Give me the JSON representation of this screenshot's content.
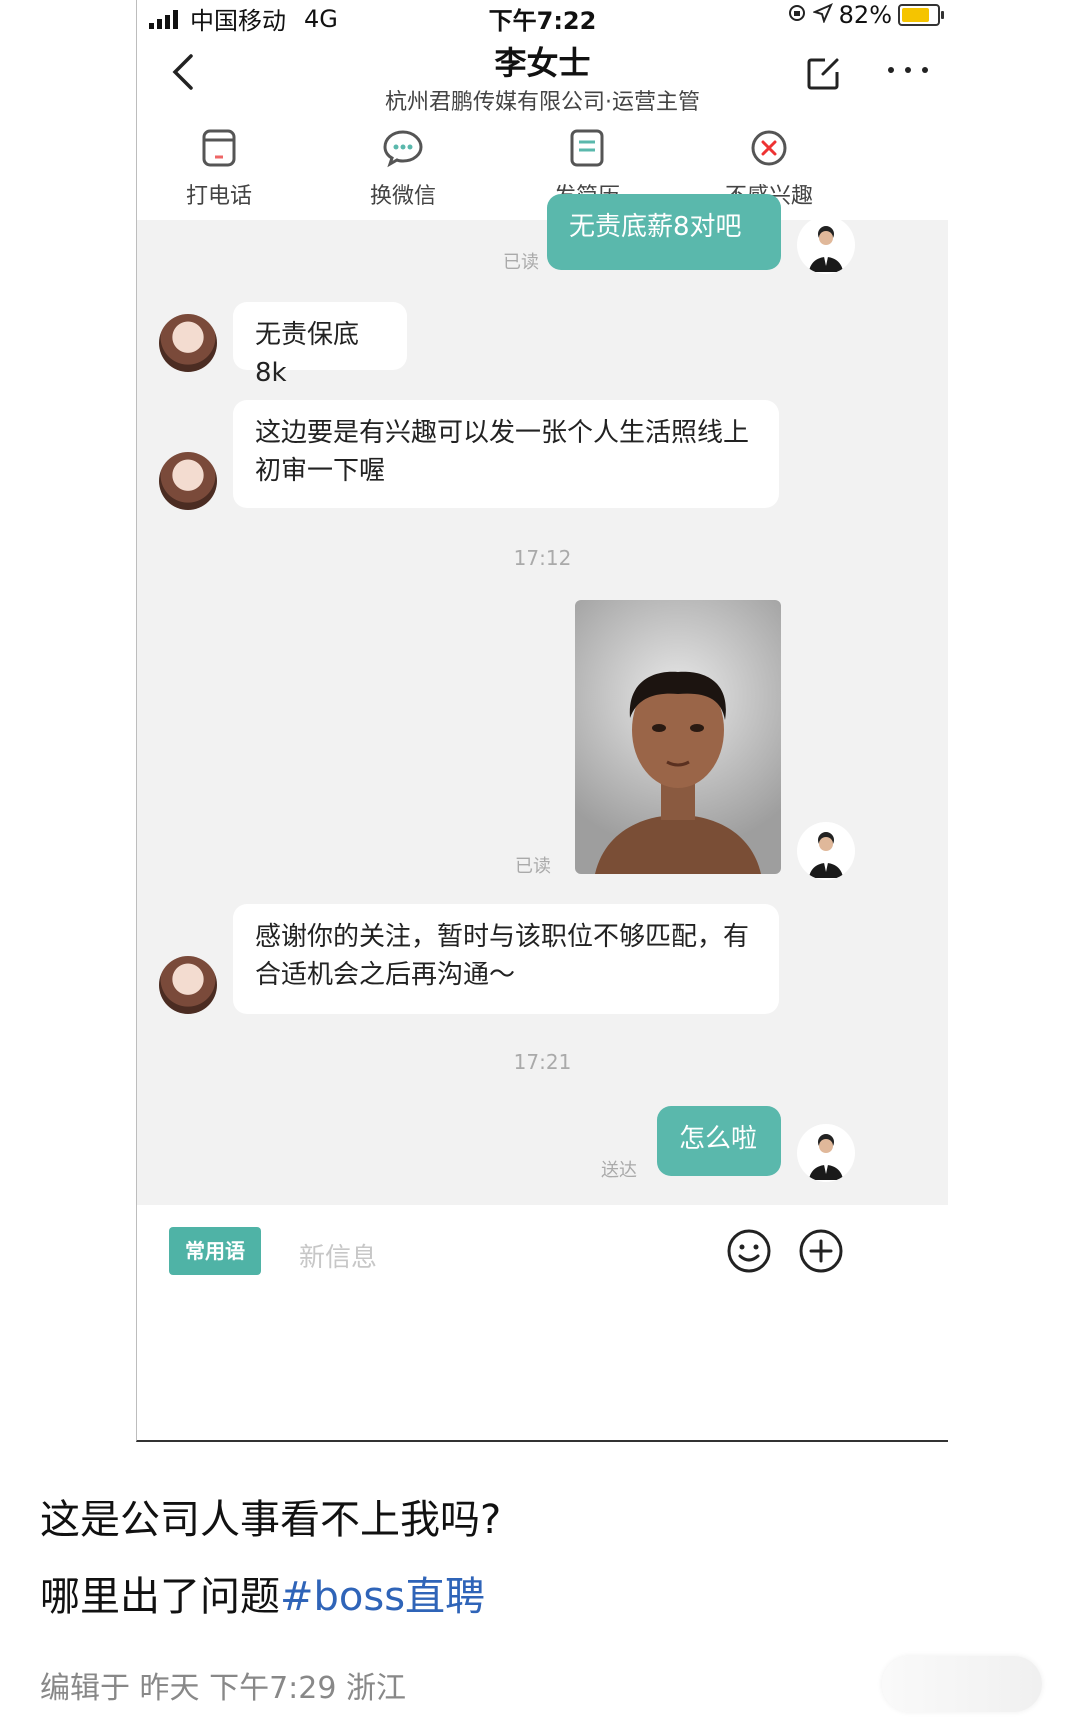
{
  "status_bar": {
    "carrier": "中国移动",
    "network": "4G",
    "time": "下午7:22",
    "battery": "82%"
  },
  "header": {
    "title": "李女士",
    "subtitle": "杭州君鹏传媒有限公司·运营主管"
  },
  "actions": [
    {
      "label": "打电话",
      "icon": "phone-icon"
    },
    {
      "label": "换微信",
      "icon": "wechat-icon"
    },
    {
      "label": "发简历",
      "icon": "resume-icon"
    },
    {
      "label": "不感兴趣",
      "icon": "not-interested-icon"
    }
  ],
  "messages": {
    "m1_out": "无责底薪8对吧",
    "m1_status": "已读",
    "m2_in": "无责保底8k",
    "m3_in": "这边要是有兴趣可以发一张个人生活照线上初审一下喔",
    "ts1": "17:12",
    "photo_status": "已读",
    "m4_in": "感谢你的关注，暂时与该职位不够匹配，有合适机会之后再沟通～",
    "ts2": "17:21",
    "m5_out": "怎么啦",
    "m5_status": "送达"
  },
  "input_bar": {
    "quick_phrases": "常用语",
    "placeholder": "新信息"
  },
  "post": {
    "line1": "这是公司人事看不上我吗?",
    "line2_prefix": "哪里出了问题",
    "hashtag": "#boss直聘",
    "meta": "编辑于  昨天  下午7:29  浙江"
  },
  "colors": {
    "accent": "#5ab8ac",
    "hashtag": "#2f64b8",
    "chat_bg": "#f2f2f2"
  }
}
